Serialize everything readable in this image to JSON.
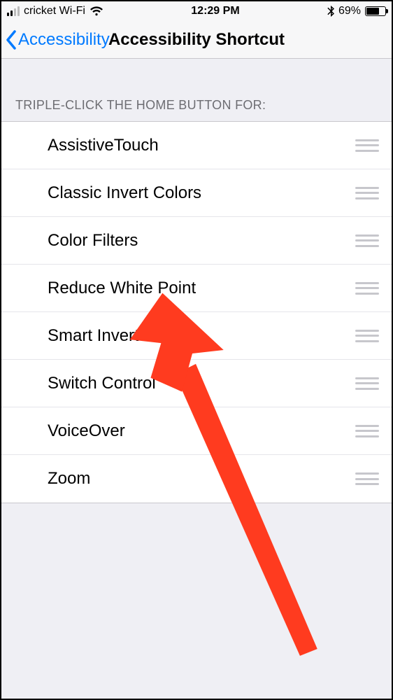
{
  "status": {
    "carrier": "cricket Wi-Fi",
    "time": "12:29 PM",
    "battery_pct": "69%",
    "battery_fill_pct": 69
  },
  "nav": {
    "back_label": "Accessibility",
    "title": "Accessibility Shortcut"
  },
  "section_header": "TRIPLE-CLICK THE HOME BUTTON FOR:",
  "items": [
    {
      "label": "AssistiveTouch"
    },
    {
      "label": "Classic Invert Colors"
    },
    {
      "label": "Color Filters"
    },
    {
      "label": "Reduce White Point"
    },
    {
      "label": "Smart Invert Colors"
    },
    {
      "label": "Switch Control"
    },
    {
      "label": "VoiceOver"
    },
    {
      "label": "Zoom"
    }
  ],
  "annotation": {
    "target_item": "Reduce White Point",
    "color": "#ff3b1f"
  }
}
